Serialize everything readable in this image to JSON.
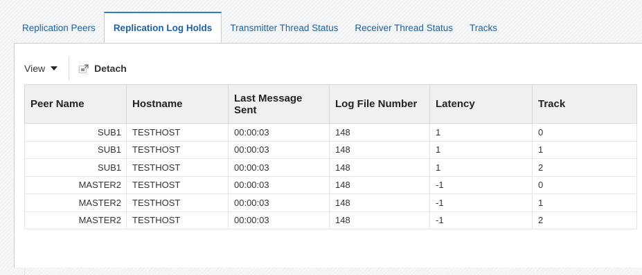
{
  "tabs": [
    {
      "label": "Replication Peers",
      "active": false
    },
    {
      "label": "Replication Log Holds",
      "active": true
    },
    {
      "label": "Transmitter Thread Status",
      "active": false
    },
    {
      "label": "Receiver Thread Status",
      "active": false
    },
    {
      "label": "Tracks",
      "active": false
    }
  ],
  "toolbar": {
    "view_label": "View",
    "detach_label": "Detach"
  },
  "table": {
    "columns": [
      "Peer Name",
      "Hostname",
      "Last Message Sent",
      "Log File Number",
      "Latency",
      "Track"
    ],
    "rows": [
      [
        "SUB1",
        "TESTHOST",
        "00:00:03",
        "148",
        "1",
        "0"
      ],
      [
        "SUB1",
        "TESTHOST",
        "00:00:03",
        "148",
        "1",
        "1"
      ],
      [
        "SUB1",
        "TESTHOST",
        "00:00:03",
        "148",
        "1",
        "2"
      ],
      [
        "MASTER2",
        "TESTHOST",
        "00:00:03",
        "148",
        "-1",
        "0"
      ],
      [
        "MASTER2",
        "TESTHOST",
        "00:00:03",
        "148",
        "-1",
        "1"
      ],
      [
        "MASTER2",
        "TESTHOST",
        "00:00:03",
        "148",
        "-1",
        "2"
      ]
    ]
  },
  "colors": {
    "tab_text": "#1f5f9e",
    "active_tab_accent": "#2b7bd6",
    "header_bg": "#eef0f2"
  },
  "icons": {
    "view_caret": "caret-down-icon",
    "detach": "detach-icon"
  }
}
